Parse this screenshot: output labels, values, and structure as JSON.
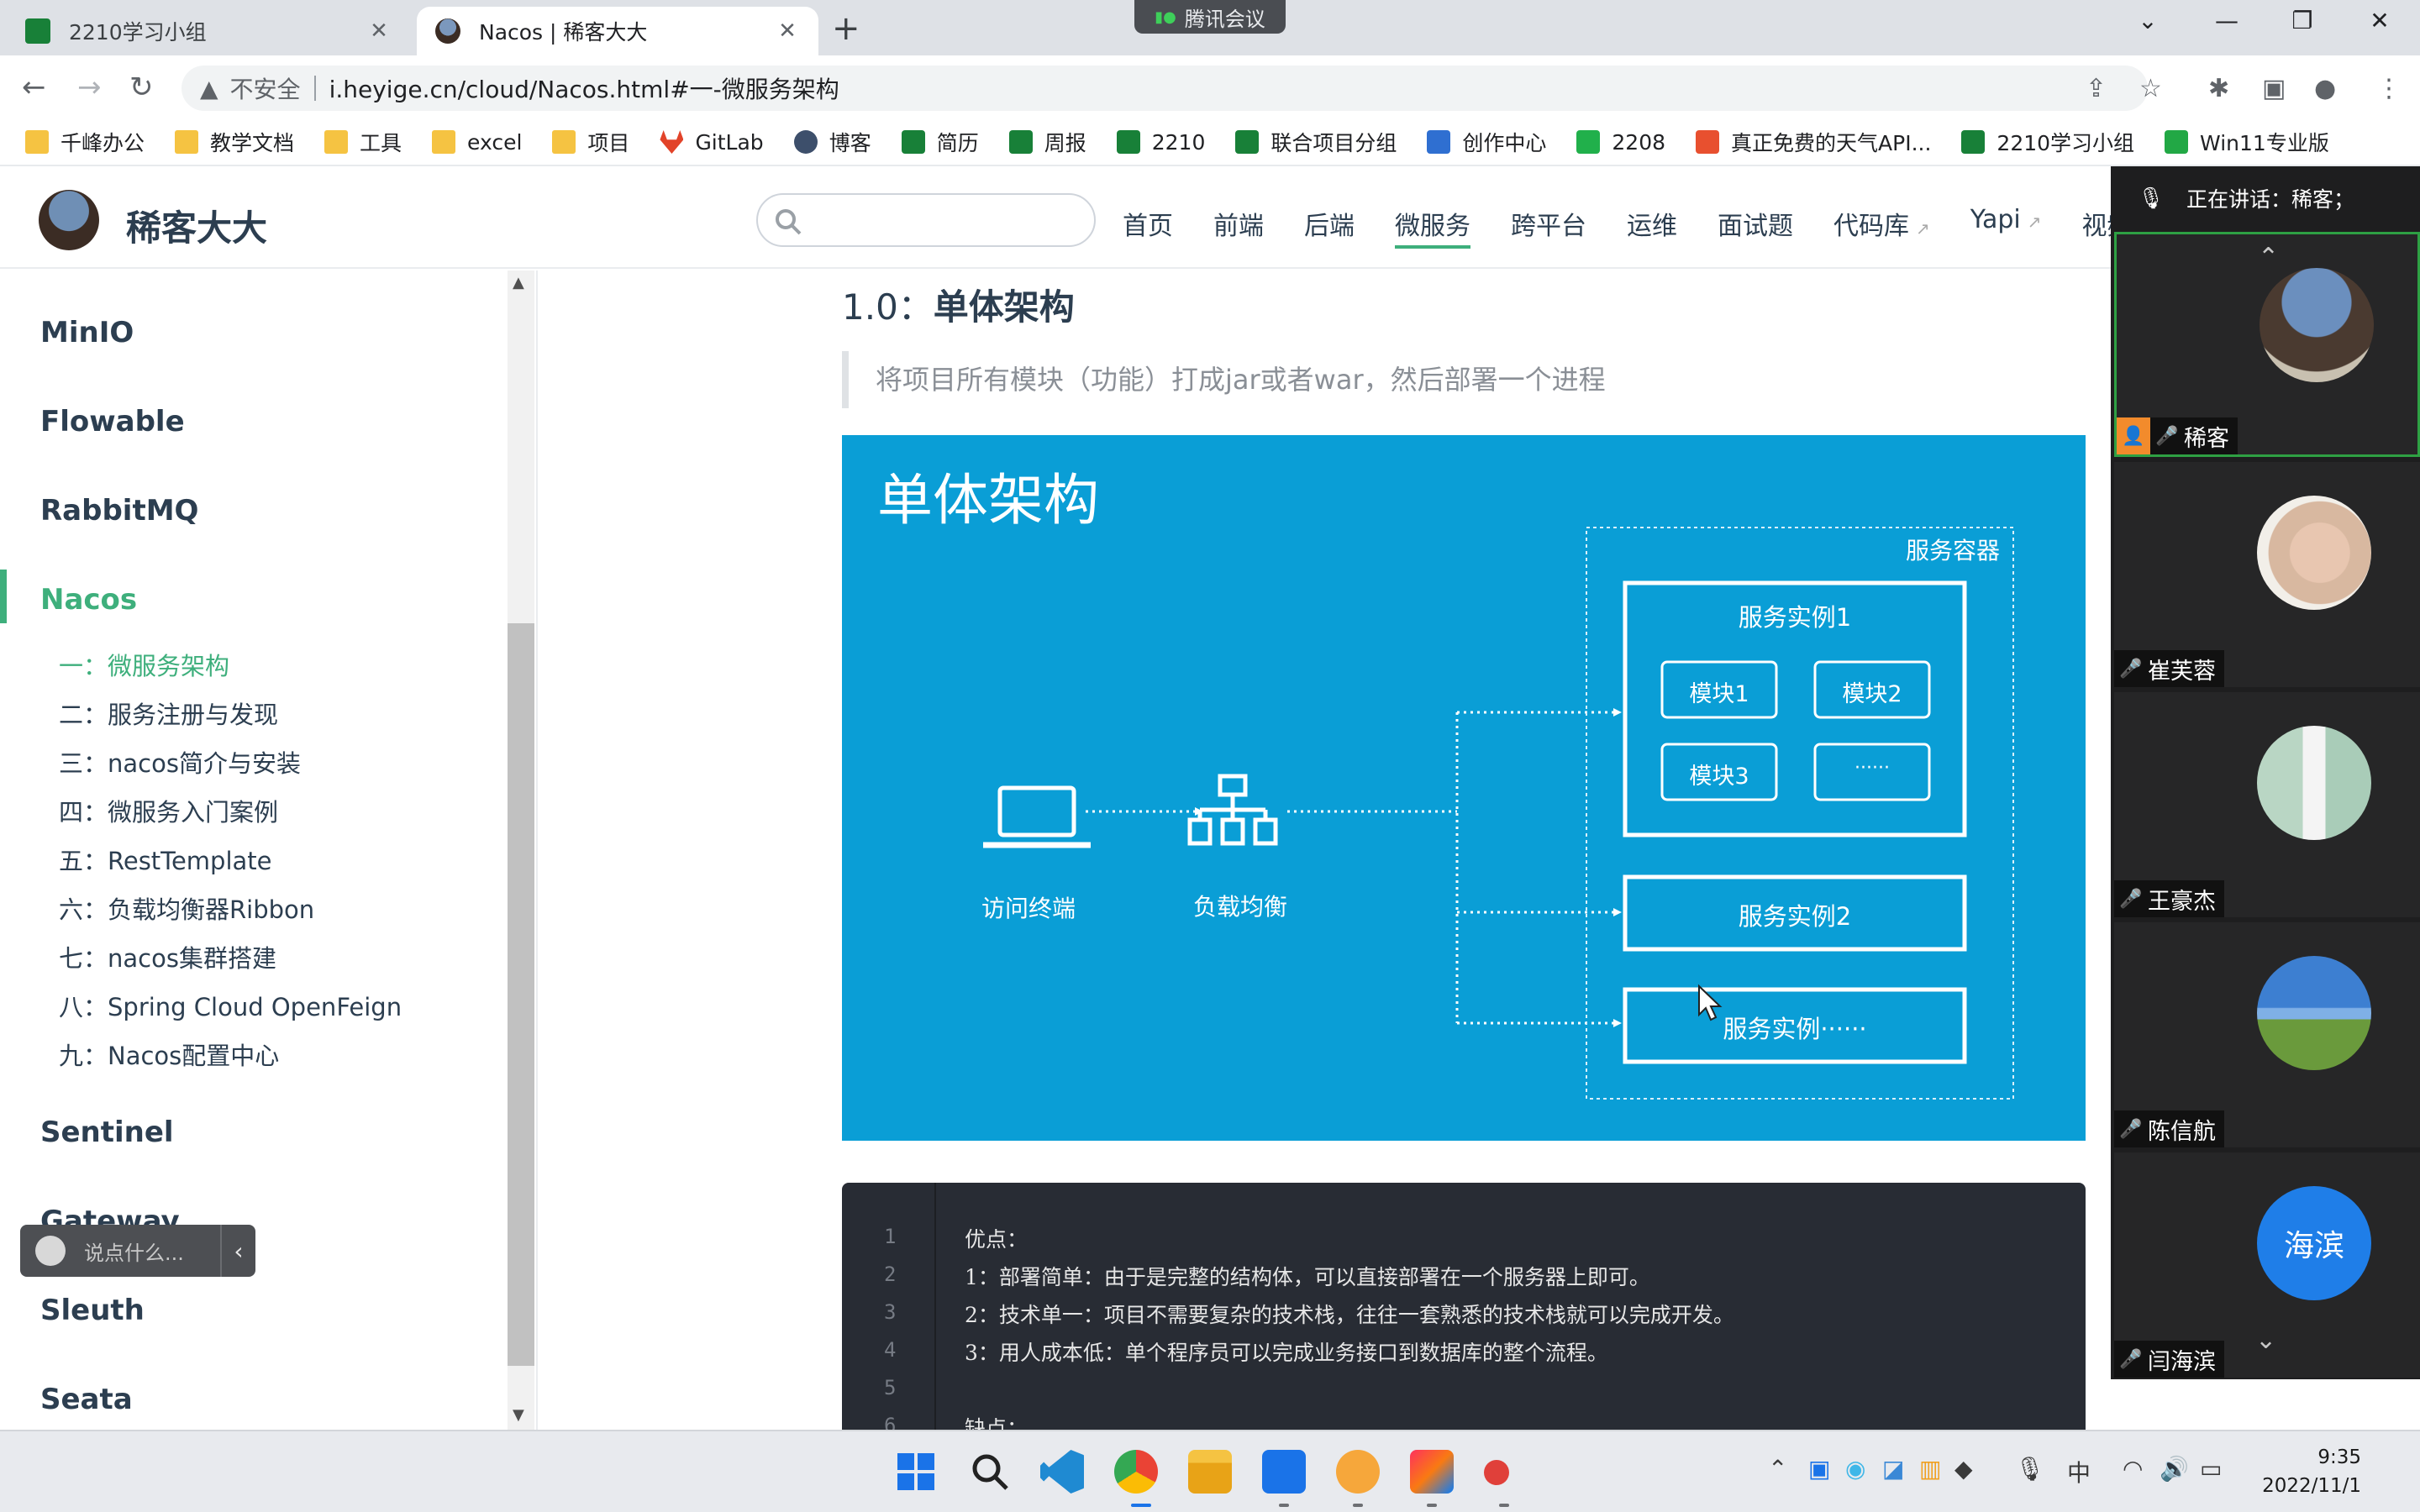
{
  "browser": {
    "tabs": [
      {
        "title": "2210学习小组",
        "active": false
      },
      {
        "title": "Nacos | 稀客大大",
        "active": true
      }
    ],
    "meeting_pill": "腾讯会议",
    "address": {
      "security_label": "不安全",
      "url": "i.heyige.cn/cloud/Nacos.html#一-微服务架构"
    },
    "bookmarks": [
      "千峰办公",
      "教学文档",
      "工具",
      "excel",
      "项目",
      "GitLab",
      "博客",
      "简历",
      "周报",
      "2210",
      "联合项目分组",
      "创作中心",
      "2208",
      "真正免费的天气API...",
      "2210学习小组",
      "Win11专业版"
    ]
  },
  "site": {
    "name": "稀客大大",
    "nav": [
      "首页",
      "前端",
      "后端",
      "微服务",
      "跨平台",
      "运维",
      "面试题",
      "代码库",
      "Yapi",
      "视频"
    ],
    "active_nav": "微服务"
  },
  "sidebar": {
    "groups_top": [
      "MinIO",
      "Flowable",
      "RabbitMQ",
      "Nacos"
    ],
    "active_group": "Nacos",
    "sub_items": [
      "一：微服务架构",
      "二：服务注册与发现",
      "三：nacos简介与安装",
      "四：微服务入门案例",
      "五：RestTemplate",
      "六：负载均衡器Ribbon",
      "七：nacos集群搭建",
      "八：Spring Cloud OpenFeign",
      "九：Nacos配置中心"
    ],
    "groups_bottom": [
      "Sentinel",
      "Gateway",
      "Sleuth",
      "Seata"
    ]
  },
  "chat": {
    "placeholder": "说点什么..."
  },
  "content": {
    "heading_prefix": "1.0：",
    "heading_bold": "单体架构",
    "quote": "将项目所有模块（功能）打成jar或者war，然后部署一个进程",
    "diagram": {
      "title": "单体架构",
      "client_label": "访问终端",
      "lb_label": "负载均衡",
      "container_label": "服务容器",
      "instance1": "服务实例1",
      "modules": [
        "模块1",
        "模块2",
        "模块3",
        "······"
      ],
      "instance2": "服务实例2",
      "instance3": "服务实例······"
    },
    "code": {
      "line_numbers": [
        "1",
        "2",
        "3",
        "4",
        "5",
        "6"
      ],
      "lines": [
        "优点：",
        "1：部署简单：由于是完整的结构体，可以直接部署在一个服务器上即可。",
        "2：技术单一：项目不需要复杂的技术栈，往往一套熟悉的技术栈就可以完成开发。",
        "3：用人成本低：单个程序员可以完成业务接口到数据库的整个流程。",
        "",
        "缺点："
      ]
    }
  },
  "meeting": {
    "speaking_text": "正在讲话：稀客；",
    "participants": [
      {
        "name": "稀客",
        "host": true,
        "muted": false
      },
      {
        "name": "崔芙蓉",
        "host": false,
        "muted": true
      },
      {
        "name": "王豪杰",
        "host": false,
        "muted": true
      },
      {
        "name": "陈信航",
        "host": false,
        "muted": true
      },
      {
        "name": "闫海滨",
        "host": false,
        "muted": true,
        "avatar_text": "海滨"
      }
    ]
  },
  "taskbar": {
    "time": "9:35",
    "date": "2022/11/1",
    "ime": "中"
  },
  "colors": {
    "accent": "#3eaf7c",
    "diagram_bg": "#0a9ed6",
    "code_bg": "#282c34",
    "meeting_bg": "#1e1e1f"
  }
}
